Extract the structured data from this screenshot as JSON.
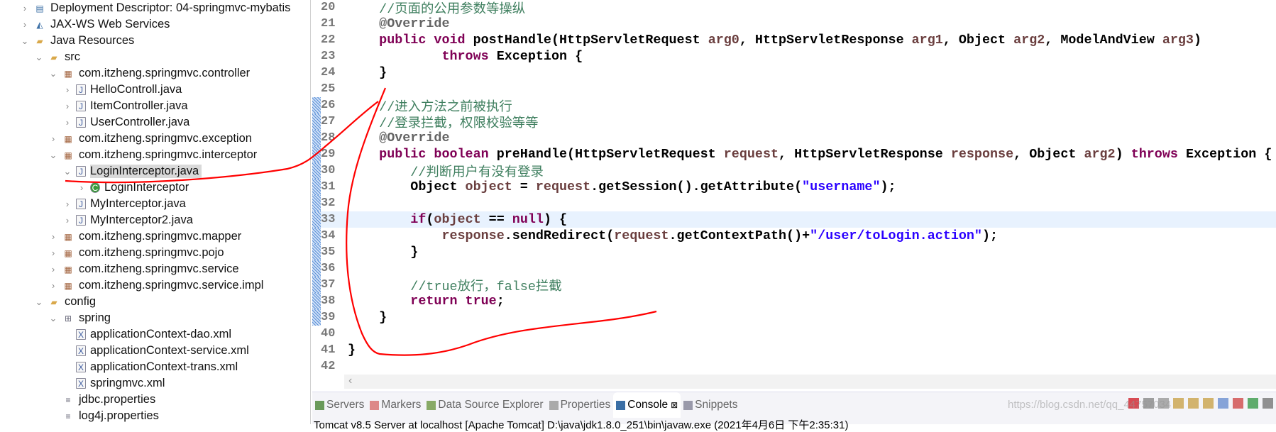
{
  "explorer": {
    "items": [
      {
        "level": 0,
        "chevron": ">",
        "icon": "deployment-descriptor-icon",
        "label": "Deployment Descriptor: 04-springmvc-mybatis"
      },
      {
        "level": 0,
        "chevron": ">",
        "icon": "web-services-icon",
        "label": "JAX-WS Web Services"
      },
      {
        "level": 0,
        "chevron": "v",
        "icon": "java-resources-icon",
        "label": "Java Resources"
      },
      {
        "level": 1,
        "chevron": "v",
        "icon": "source-folder-icon",
        "label": "src"
      },
      {
        "level": 2,
        "chevron": "v",
        "icon": "package-icon",
        "label": "com.itzheng.springmvc.controller"
      },
      {
        "level": 3,
        "chevron": ">",
        "icon": "java-file-icon",
        "label": "HelloControll.java"
      },
      {
        "level": 3,
        "chevron": ">",
        "icon": "java-file-icon",
        "label": "ItemController.java"
      },
      {
        "level": 3,
        "chevron": ">",
        "icon": "java-file-icon",
        "label": "UserController.java"
      },
      {
        "level": 2,
        "chevron": ">",
        "icon": "package-icon",
        "label": "com.itzheng.springmvc.exception"
      },
      {
        "level": 2,
        "chevron": "v",
        "icon": "package-icon",
        "label": "com.itzheng.springmvc.interceptor"
      },
      {
        "level": 3,
        "chevron": "v",
        "icon": "java-file-icon",
        "label": "LoginInterceptor.java",
        "selected": true
      },
      {
        "level": 4,
        "chevron": ">",
        "icon": "class-icon",
        "label": "LoginInterceptor"
      },
      {
        "level": 3,
        "chevron": ">",
        "icon": "java-file-icon",
        "label": "MyInterceptor.java"
      },
      {
        "level": 3,
        "chevron": ">",
        "icon": "java-file-icon",
        "label": "MyInterceptor2.java"
      },
      {
        "level": 2,
        "chevron": ">",
        "icon": "package-icon",
        "label": "com.itzheng.springmvc.mapper"
      },
      {
        "level": 2,
        "chevron": ">",
        "icon": "package-icon",
        "label": "com.itzheng.springmvc.pojo"
      },
      {
        "level": 2,
        "chevron": ">",
        "icon": "package-icon",
        "label": "com.itzheng.springmvc.service"
      },
      {
        "level": 2,
        "chevron": ">",
        "icon": "package-icon",
        "label": "com.itzheng.springmvc.service.impl"
      },
      {
        "level": 1,
        "chevron": "v",
        "icon": "folder-icon",
        "label": "config"
      },
      {
        "level": 2,
        "chevron": "v",
        "icon": "package-folder-icon",
        "label": "spring"
      },
      {
        "level": 3,
        "chevron": "",
        "icon": "xml-file-icon",
        "label": "applicationContext-dao.xml"
      },
      {
        "level": 3,
        "chevron": "",
        "icon": "xml-file-icon",
        "label": "applicationContext-service.xml"
      },
      {
        "level": 3,
        "chevron": "",
        "icon": "xml-file-icon",
        "label": "applicationContext-trans.xml"
      },
      {
        "level": 3,
        "chevron": "",
        "icon": "xml-file-icon",
        "label": "springmvc.xml"
      },
      {
        "level": 2,
        "chevron": "",
        "icon": "properties-file-icon",
        "label": "jdbc.properties"
      },
      {
        "level": 2,
        "chevron": "",
        "icon": "properties-file-icon",
        "label": "log4j.properties"
      }
    ]
  },
  "editor": {
    "current_line": 33,
    "changed_lines": [
      26,
      39
    ],
    "lines": [
      {
        "n": "20",
        "t": [
          [
            "",
            "    "
          ],
          [
            "cm",
            "//页面的公用参数等操纵"
          ]
        ]
      },
      {
        "n": "21",
        "t": [
          [
            "",
            "    "
          ],
          [
            "an",
            "@Override"
          ]
        ]
      },
      {
        "n": "22",
        "t": [
          [
            "",
            "    "
          ],
          [
            "kw",
            "public void "
          ],
          [
            "",
            "postHandle(HttpServletRequest "
          ],
          [
            "pr",
            "arg0"
          ],
          [
            "",
            ", HttpServletResponse "
          ],
          [
            "pr",
            "arg1"
          ],
          [
            "",
            ", Object "
          ],
          [
            "pr",
            "arg2"
          ],
          [
            "",
            ", ModelAndView "
          ],
          [
            "pr",
            "arg3"
          ],
          [
            "",
            ")"
          ]
        ]
      },
      {
        "n": "23",
        "t": [
          [
            "",
            "            "
          ],
          [
            "kw",
            "throws "
          ],
          [
            "",
            "Exception {"
          ]
        ]
      },
      {
        "n": "24",
        "t": [
          [
            "",
            "    }"
          ]
        ]
      },
      {
        "n": "25",
        "t": []
      },
      {
        "n": "26",
        "t": [
          [
            "",
            "    "
          ],
          [
            "cm",
            "//进入方法之前被执行"
          ]
        ]
      },
      {
        "n": "27",
        "t": [
          [
            "",
            "    "
          ],
          [
            "cm",
            "//登录拦截，权限校验等等"
          ]
        ]
      },
      {
        "n": "28",
        "t": [
          [
            "",
            "    "
          ],
          [
            "an",
            "@Override"
          ]
        ]
      },
      {
        "n": "29",
        "t": [
          [
            "",
            "    "
          ],
          [
            "kw",
            "public boolean "
          ],
          [
            "",
            "preHandle(HttpServletRequest "
          ],
          [
            "pr",
            "request"
          ],
          [
            "",
            ", HttpServletResponse "
          ],
          [
            "pr",
            "response"
          ],
          [
            "",
            ", Object "
          ],
          [
            "pr",
            "arg2"
          ],
          [
            "",
            ") "
          ],
          [
            "kw",
            "throws "
          ],
          [
            "",
            "Exception {"
          ]
        ]
      },
      {
        "n": "30",
        "t": [
          [
            "",
            "        "
          ],
          [
            "cm",
            "//判断用户有没有登录"
          ]
        ]
      },
      {
        "n": "31",
        "t": [
          [
            "",
            "        Object "
          ],
          [
            "pr",
            "object"
          ],
          [
            "",
            " = "
          ],
          [
            "pr",
            "request"
          ],
          [
            "",
            ".getSession().getAttribute("
          ],
          [
            "st",
            "\"username\""
          ],
          [
            "",
            ");"
          ]
        ]
      },
      {
        "n": "32",
        "t": []
      },
      {
        "n": "33",
        "t": [
          [
            "",
            "        "
          ],
          [
            "kw",
            "if"
          ],
          [
            "",
            "("
          ],
          [
            "pr",
            "object"
          ],
          [
            "",
            " == "
          ],
          [
            "kw",
            "null"
          ],
          [
            "",
            ") {"
          ]
        ]
      },
      {
        "n": "34",
        "t": [
          [
            "",
            "            "
          ],
          [
            "pr",
            "response"
          ],
          [
            "",
            ".sendRedirect("
          ],
          [
            "pr",
            "request"
          ],
          [
            "",
            ".getContextPath()+"
          ],
          [
            "st",
            "\"/user/toLogin.action\""
          ],
          [
            "",
            ");"
          ]
        ]
      },
      {
        "n": "35",
        "t": [
          [
            "",
            "        }"
          ]
        ]
      },
      {
        "n": "36",
        "t": []
      },
      {
        "n": "37",
        "t": [
          [
            "",
            "        "
          ],
          [
            "cm",
            "//true放行，false拦截"
          ]
        ]
      },
      {
        "n": "38",
        "t": [
          [
            "",
            "        "
          ],
          [
            "kw",
            "return true"
          ],
          [
            "",
            ";"
          ]
        ]
      },
      {
        "n": "39",
        "t": [
          [
            "",
            "    }"
          ]
        ]
      },
      {
        "n": "40",
        "t": []
      },
      {
        "n": "41",
        "t": [
          [
            "",
            "}"
          ]
        ]
      },
      {
        "n": "42",
        "t": []
      }
    ]
  },
  "panel": {
    "tabs": [
      {
        "label": "Servers",
        "icon": "servers-icon",
        "color": "#6a9a5a"
      },
      {
        "label": "Markers",
        "icon": "markers-icon",
        "color": "#d88"
      },
      {
        "label": "Data Source Explorer",
        "icon": "data-source-icon",
        "color": "#8a6"
      },
      {
        "label": "Properties",
        "icon": "properties-icon",
        "color": "#aaa"
      },
      {
        "label": "Console",
        "icon": "console-icon",
        "color": "#3a6ea5",
        "active": true,
        "close": "⊠"
      },
      {
        "label": "Snippets",
        "icon": "snippets-icon",
        "color": "#99a"
      }
    ],
    "tools": [
      {
        "icon": "terminate-icon",
        "color": "#d0202a"
      },
      {
        "icon": "remove-launch-icon",
        "color": "#888"
      },
      {
        "icon": "remove-all-icon",
        "color": "#999"
      },
      {
        "icon": "scroll-lock-icon",
        "color": "#c9a24a"
      },
      {
        "icon": "clear-console-icon",
        "color": "#c9a24a"
      },
      {
        "icon": "word-wrap-icon",
        "color": "#c9a24a"
      },
      {
        "icon": "show-stdout-icon",
        "color": "#6a8fcf"
      },
      {
        "icon": "show-stderr-icon",
        "color": "#cf4a4a"
      },
      {
        "icon": "pin-console-icon",
        "color": "#3a9a4a"
      },
      {
        "icon": "display-console-icon",
        "color": "#777"
      }
    ],
    "console_text": "Tomcat v8.5 Server at localhost [Apache Tomcat] D:\\java\\jdk1.8.0_251\\bin\\javaw.exe (2021年4月6日 下午2:35:31)",
    "scroll_left": "‹"
  },
  "watermark": "https://blog.csdn.net/qq_44757034",
  "annotation_color": "#ff0000"
}
